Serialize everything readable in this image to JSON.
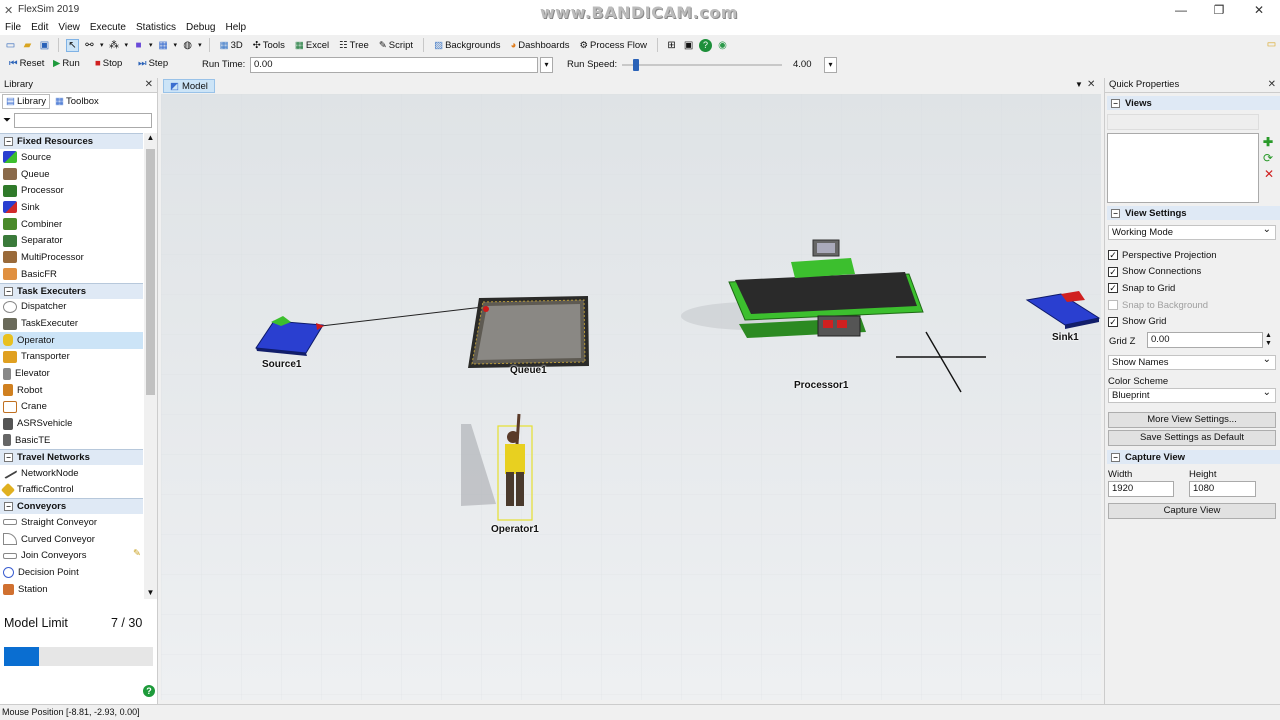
{
  "window": {
    "title": "FlexSim 2019",
    "watermark": "www.BANDICAM.com"
  },
  "menu": [
    "File",
    "Edit",
    "View",
    "Execute",
    "Statistics",
    "Debug",
    "Help"
  ],
  "toolbar": {
    "buttons": [
      "3D",
      "Tools",
      "Excel",
      "Tree",
      "Script",
      "Backgrounds",
      "Dashboards",
      "Process Flow"
    ]
  },
  "run_controls": {
    "reset": "Reset",
    "run": "Run",
    "stop": "Stop",
    "step": "Step",
    "run_time_label": "Run Time:",
    "run_time_value": "0.00",
    "run_speed_label": "Run Speed:",
    "run_speed_value": "4.00"
  },
  "library": {
    "title": "Library",
    "tabs": [
      "Library",
      "Toolbox"
    ],
    "categories": [
      {
        "name": "Fixed Resources",
        "items": [
          "Source",
          "Queue",
          "Processor",
          "Sink",
          "Combiner",
          "Separator",
          "MultiProcessor",
          "BasicFR"
        ]
      },
      {
        "name": "Task Executers",
        "items": [
          "Dispatcher",
          "TaskExecuter",
          "Operator",
          "Transporter",
          "Elevator",
          "Robot",
          "Crane",
          "ASRSvehicle",
          "BasicTE"
        ]
      },
      {
        "name": "Travel Networks",
        "items": [
          "NetworkNode",
          "TrafficControl"
        ]
      },
      {
        "name": "Conveyors",
        "items": [
          "Straight Conveyor",
          "Curved Conveyor",
          "Join Conveyors",
          "Decision Point",
          "Station"
        ]
      }
    ],
    "selected_item": "Operator",
    "model_limit_label": "Model Limit",
    "model_limit_value": "7 / 30",
    "model_limit_progress": 0.233
  },
  "model": {
    "tab": "Model",
    "objects": {
      "source": "Source1",
      "queue": "Queue1",
      "processor": "Processor1",
      "sink": "Sink1",
      "operator": "Operator1"
    }
  },
  "quick_properties": {
    "title": "Quick Properties",
    "views_section": "Views",
    "view_settings_section": "View Settings",
    "mode": "Working Mode",
    "checkboxes": [
      {
        "label": "Perspective Projection",
        "checked": true
      },
      {
        "label": "Show Connections",
        "checked": true
      },
      {
        "label": "Snap to Grid",
        "checked": true
      },
      {
        "label": "Snap to Background",
        "checked": false
      },
      {
        "label": "Show Grid",
        "checked": true
      }
    ],
    "grid_z_label": "Grid Z",
    "grid_z_value": "0.00",
    "show_names": "Show Names",
    "color_scheme_label": "Color Scheme",
    "color_scheme": "Blueprint",
    "more_settings": "More View Settings...",
    "save_default": "Save Settings as Default",
    "capture_section": "Capture View",
    "width_label": "Width",
    "width_value": "1920",
    "height_label": "Height",
    "height_value": "1080",
    "capture_button": "Capture View"
  },
  "status": {
    "mouse_position": "Mouse Position [-8.81, -2.93, 0.00]"
  },
  "colors": {
    "accent": "#0a6ed1",
    "category_bg": "#dfe9f5",
    "selected": "#cce4f7",
    "sink_blue": "#2a3fd0",
    "processor_green": "#3cbf2e"
  }
}
